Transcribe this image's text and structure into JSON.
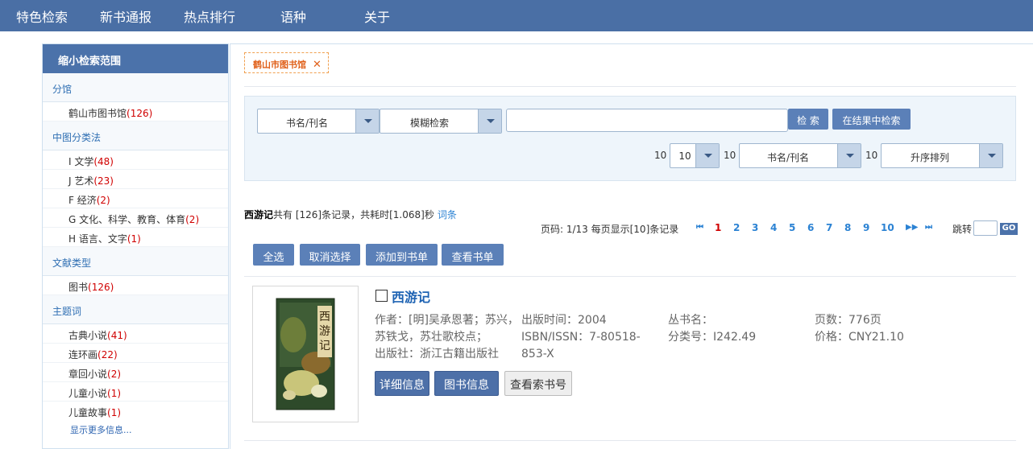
{
  "topnav": {
    "items": [
      "特色检索",
      "新书通报",
      "热点排行",
      "语种",
      "关于"
    ]
  },
  "sidebar": {
    "title": "缩小检索范围",
    "sections": [
      {
        "title": "分馆",
        "items": [
          {
            "label": "鹤山市图书馆",
            "count": "(126)"
          }
        ]
      },
      {
        "title": "中图分类法",
        "items": [
          {
            "label": "I 文学",
            "count": "(48)"
          },
          {
            "label": "J 艺术",
            "count": "(23)"
          },
          {
            "label": "F 经济",
            "count": "(2)"
          },
          {
            "label": "G 文化、科学、教育、体育",
            "count": "(2)"
          },
          {
            "label": "H 语言、文字",
            "count": "(1)"
          }
        ]
      },
      {
        "title": "文献类型",
        "items": [
          {
            "label": "图书",
            "count": "(126)"
          }
        ]
      },
      {
        "title": "主题词",
        "items": [
          {
            "label": "古典小说",
            "count": "(41)"
          },
          {
            "label": "连环画",
            "count": "(22)"
          },
          {
            "label": "章回小说",
            "count": "(2)"
          },
          {
            "label": "儿童小说",
            "count": "(1)"
          },
          {
            "label": "儿童故事",
            "count": "(1)"
          }
        ]
      }
    ],
    "more": "显示更多信息..."
  },
  "filter": {
    "tag": "鹤山市图书馆",
    "close": "✕"
  },
  "search": {
    "field_select": "书名/刊名",
    "mode_select": "模糊检索",
    "query_value": "",
    "search_btn": "检 索",
    "within_btn": "在结果中检索",
    "page_size_label": "10",
    "page_size_select": "10",
    "sort_field_label": "10",
    "sort_field_select": "书名/刊名",
    "sort_order_label": "10",
    "sort_order_select": "升序排列"
  },
  "results": {
    "query": "西游记",
    "summary": "共有 [126]条记录，共耗时[1.068]秒",
    "link": "词条",
    "pager_text": "页码: 1/13 每页显示[10]条记录",
    "pages": [
      "1",
      "2",
      "3",
      "4",
      "5",
      "6",
      "7",
      "8",
      "9",
      "10"
    ],
    "current_page": "1",
    "first_icon": "⏮",
    "prev_icon": "◀◀",
    "next_icon": "▶▶",
    "last_icon": "⏭",
    "jump_label": "跳转",
    "go": "GO"
  },
  "actions": {
    "select_all": "全选",
    "cancel_select": "取消选择",
    "add_to_list": "添加到书单",
    "view_list": "查看书单"
  },
  "book": {
    "title": "西游记",
    "author_line1": "作者：[明]吴承恩著；苏兴，",
    "author_line2": "苏铁戈，苏壮歌校点；",
    "publisher": "出版社：浙江古籍出版社",
    "pubdate": "出版时间：2004",
    "isbn_line1": "ISBN/ISSN：7-80518-",
    "isbn_line2": "853-X",
    "series": "丛书名：",
    "classno": "分类号：I242.49",
    "pages": "页数：776页",
    "price": "价格：CNY21.10",
    "btn_detail": "详细信息",
    "btn_bookinfo": "图书信息",
    "btn_callno": "查看索书号"
  },
  "colors": {
    "nav_bg": "#4a6fa5",
    "accent": "#4b72aa",
    "count_red": "#d00000",
    "link_blue": "#2b82d3"
  }
}
